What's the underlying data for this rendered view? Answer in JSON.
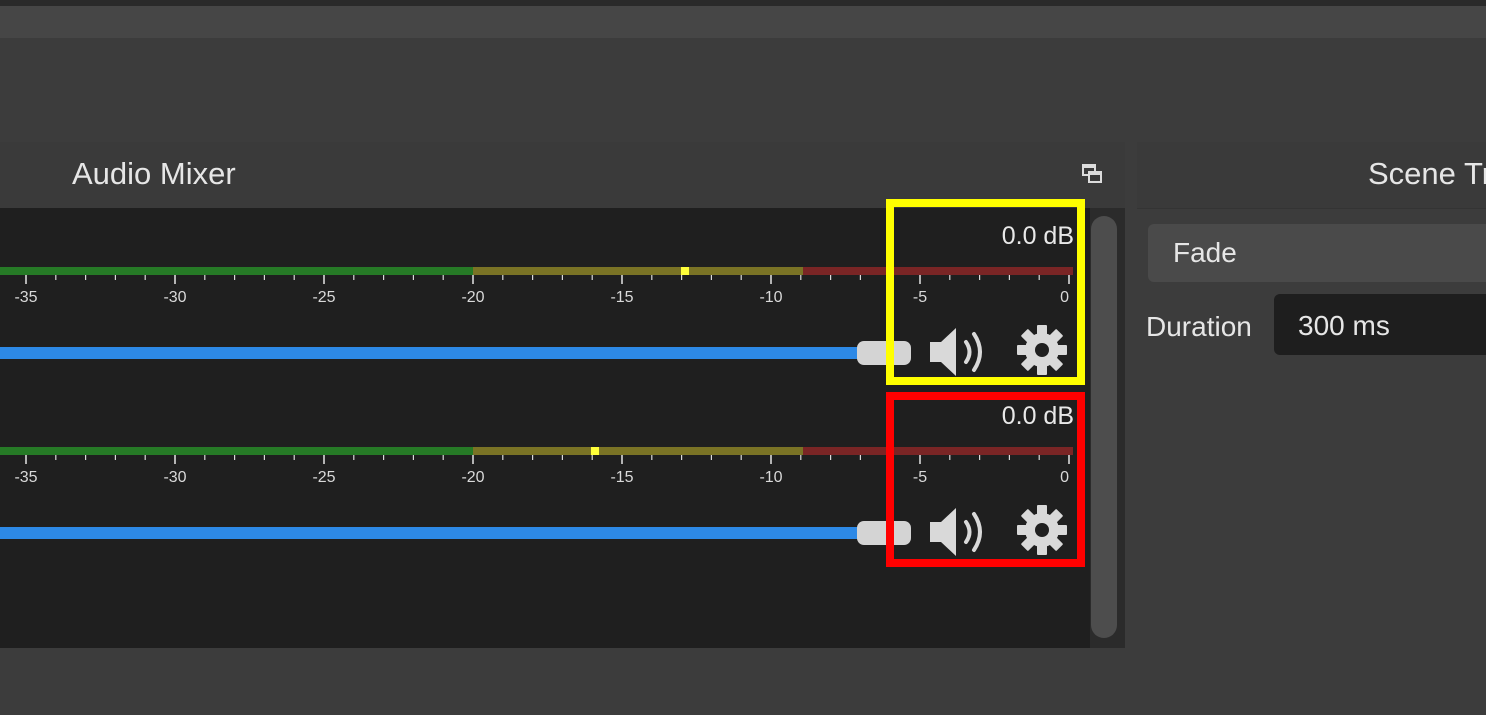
{
  "audio_mixer": {
    "title": "Audio Mixer",
    "channels": [
      {
        "level": "0.0 dB",
        "peak_db": -12.9
      },
      {
        "level": "0.0 dB",
        "peak_db": -15.9
      }
    ],
    "meter_ticks": [
      "-35",
      "-30",
      "-25",
      "-20",
      "-15",
      "-10",
      "-5",
      "0"
    ],
    "colors": {
      "meter_green": "#267a26",
      "meter_yellow": "#7a7325",
      "meter_red": "#7a2525",
      "fader": "#2d89e6",
      "peak": "#ffff3a"
    }
  },
  "highlights": {
    "first": "#ffff00",
    "second": "#ff0000"
  },
  "scene_transitions": {
    "title": "Scene Tr",
    "transition": "Fade",
    "duration_label": "Duration",
    "duration_value": "300 ms"
  }
}
